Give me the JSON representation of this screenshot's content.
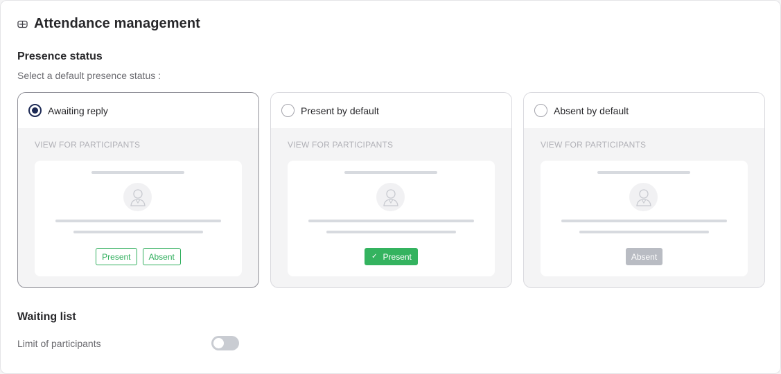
{
  "header": {
    "title": "Attendance management",
    "icon": "ticket-icon"
  },
  "presence": {
    "title": "Presence status",
    "subtitle": "Select a default presence status :",
    "options": [
      {
        "label": "Awaiting reply",
        "selected": true,
        "view_label": "VIEW FOR PARTICIPANTS",
        "buttons": [
          "Present",
          "Absent"
        ]
      },
      {
        "label": "Present by default",
        "selected": false,
        "view_label": "VIEW FOR PARTICIPANTS",
        "buttons": [
          "Present"
        ]
      },
      {
        "label": "Absent by default",
        "selected": false,
        "view_label": "VIEW FOR PARTICIPANTS",
        "buttons": [
          "Absent"
        ]
      }
    ]
  },
  "waiting_list": {
    "title": "Waiting list",
    "limit_label": "Limit of participants",
    "limit_enabled": false
  },
  "colors": {
    "accent": "#1d2a55",
    "present": "#34b35f",
    "absent": "#b9bcc3"
  }
}
